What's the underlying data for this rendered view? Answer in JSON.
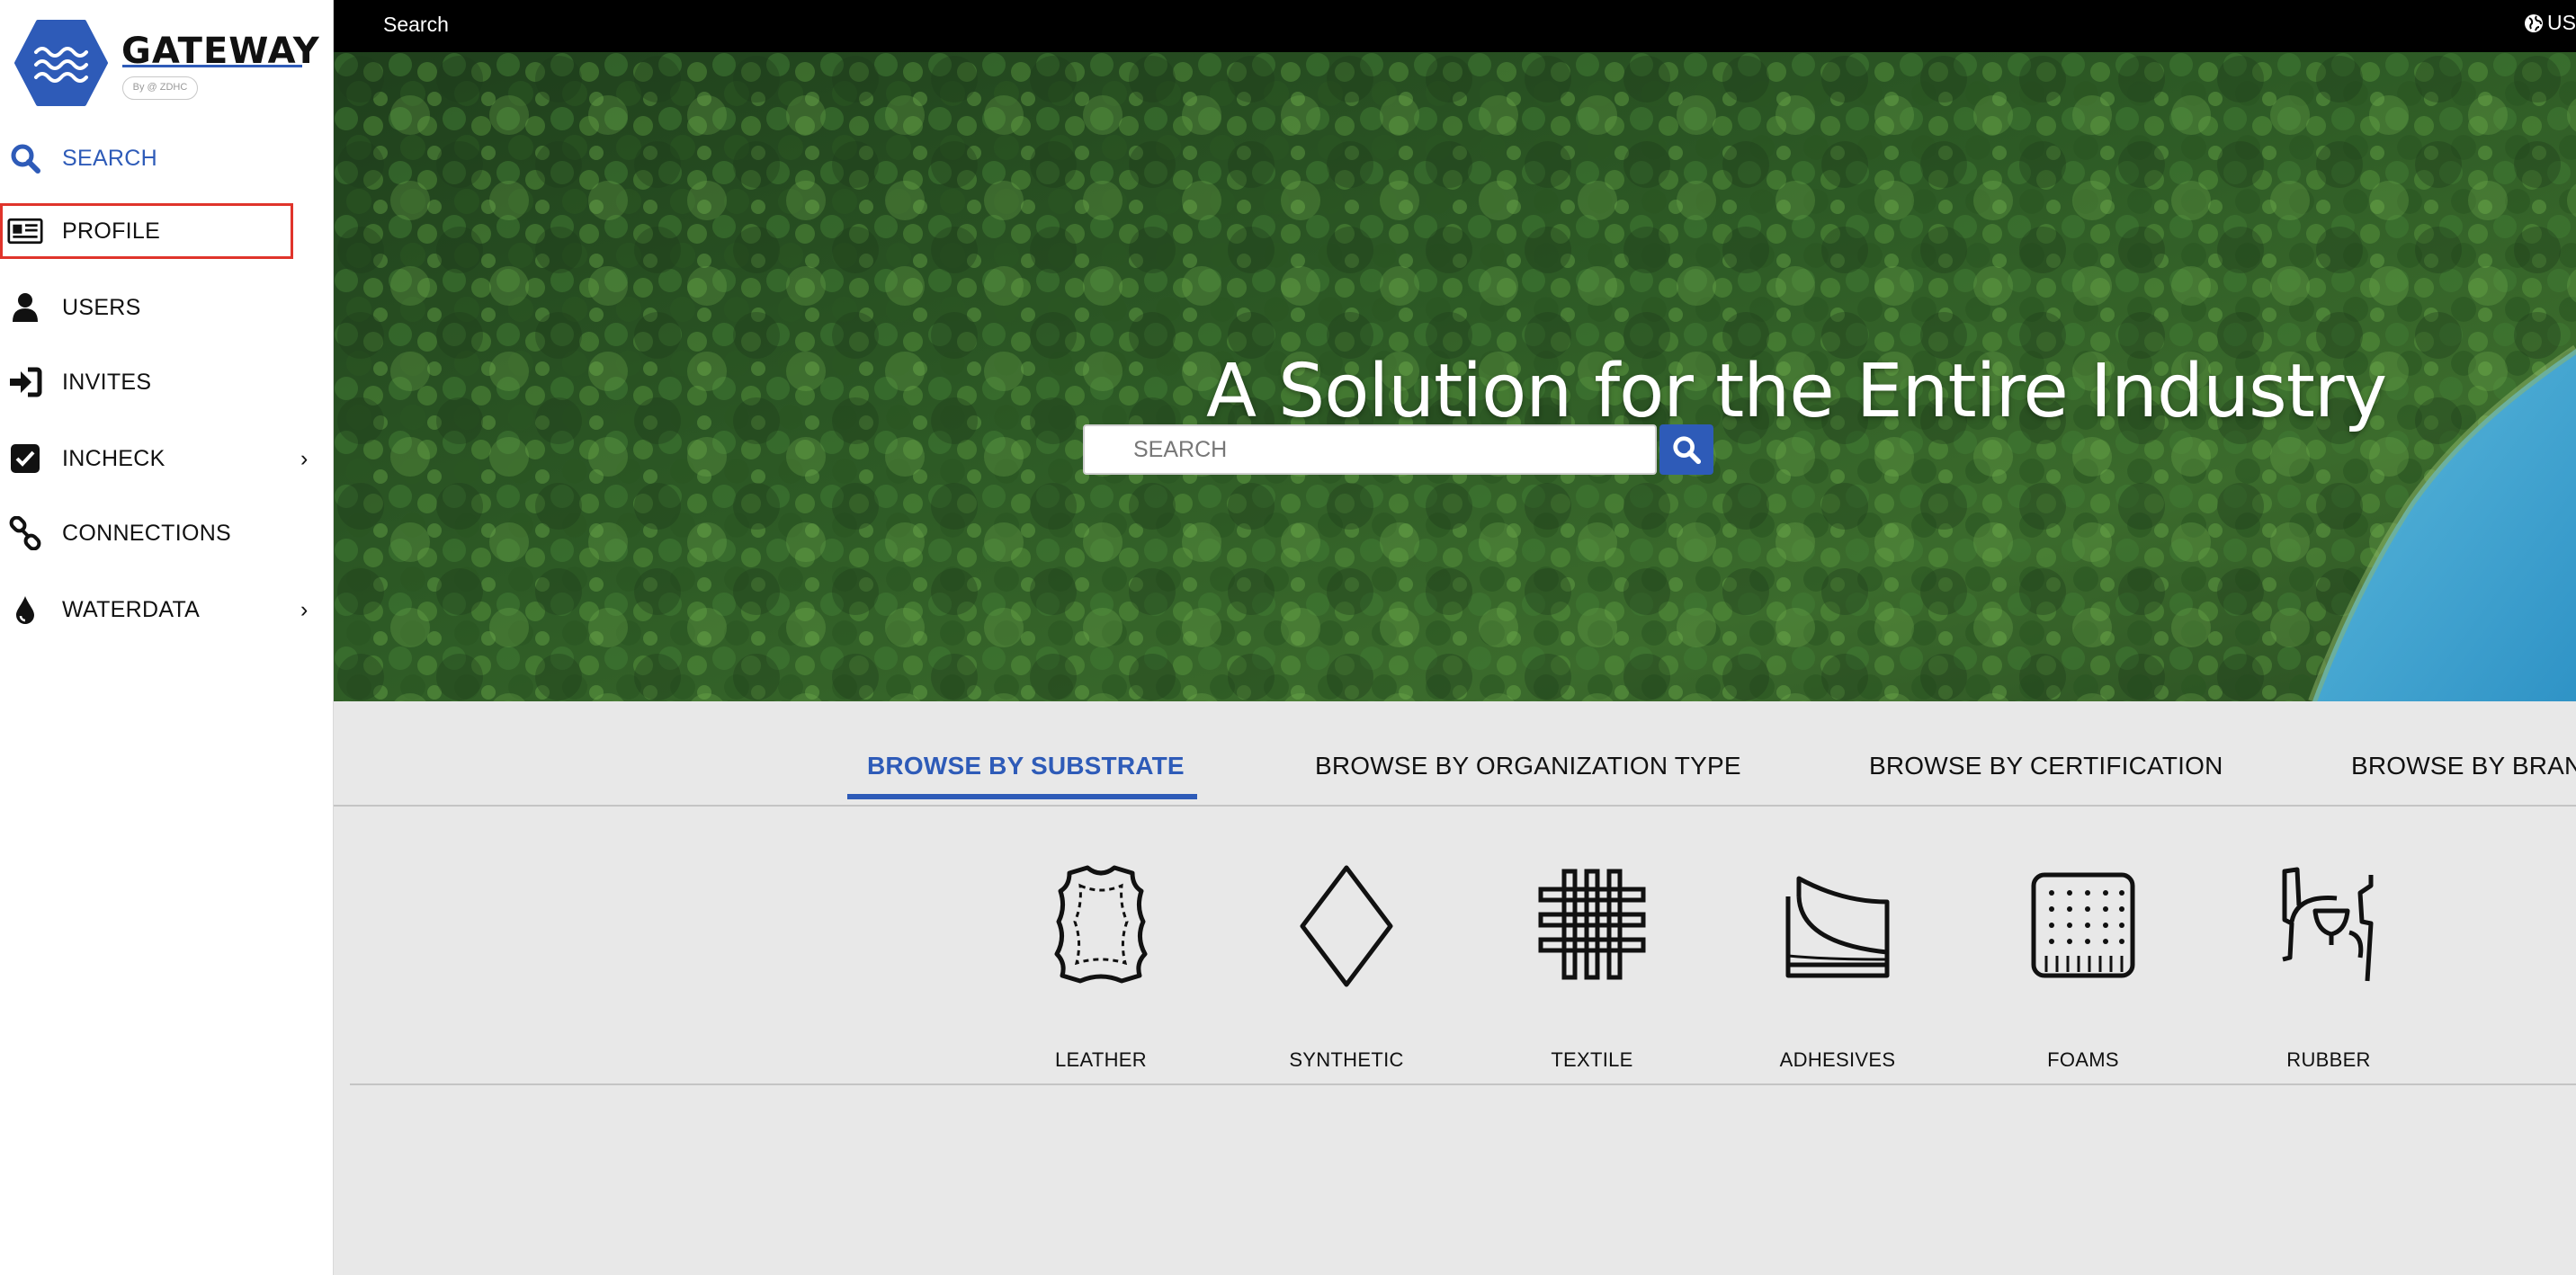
{
  "brand": {
    "name": "GATEWAY",
    "badge_text": "By @ ZDHC",
    "accent_color": "#2e5bb8"
  },
  "topbar": {
    "search_link": "Search",
    "locale": "US",
    "locale_icon": "globe-icon"
  },
  "sidebar": {
    "items": [
      {
        "label": "SEARCH",
        "icon": "search-icon",
        "active": true
      },
      {
        "label": "PROFILE",
        "icon": "id-card-icon",
        "highlighted": true
      },
      {
        "label": "USERS",
        "icon": "user-icon"
      },
      {
        "label": "INVITES",
        "icon": "sign-in-icon"
      },
      {
        "label": "INCHECK",
        "icon": "check-square-icon",
        "has_submenu": true
      },
      {
        "label": "CONNECTIONS",
        "icon": "link-icon"
      },
      {
        "label": "WATERDATA",
        "icon": "drop-icon",
        "has_submenu": true
      }
    ],
    "chevron": "›"
  },
  "hero": {
    "title": "A Solution for the Entire Industry",
    "search_placeholder": "SEARCH",
    "search_button_icon": "search-icon"
  },
  "tabs": [
    {
      "label": "BROWSE BY SUBSTRATE",
      "active": true
    },
    {
      "label": "BROWSE BY ORGANIZATION TYPE"
    },
    {
      "label": "BROWSE BY CERTIFICATION"
    },
    {
      "label": "BROWSE BY BRAN"
    }
  ],
  "substrates": [
    {
      "label": "LEATHER",
      "icon": "leather-icon"
    },
    {
      "label": "SYNTHETIC",
      "icon": "diamond-icon"
    },
    {
      "label": "TEXTILE",
      "icon": "weave-icon"
    },
    {
      "label": "ADHESIVES",
      "icon": "adhesive-icon"
    },
    {
      "label": "FOAMS",
      "icon": "foam-icon"
    },
    {
      "label": "RUBBER",
      "icon": "rubber-tap-icon"
    }
  ]
}
